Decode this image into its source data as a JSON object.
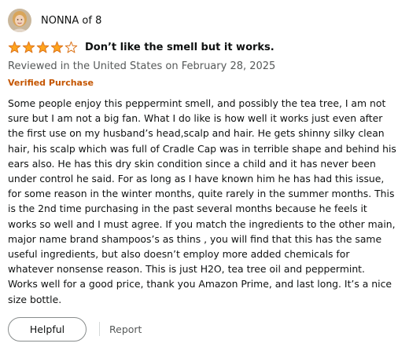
{
  "colors": {
    "star_fill": "#ffa41c",
    "star_outline": "#de7921",
    "verified": "#c45500",
    "muted_text": "#565959",
    "body_text": "#0f1111"
  },
  "review": {
    "profile_name": "NONNA of 8",
    "avatar_icon": "profile-photo",
    "rating": 4,
    "rating_max": 5,
    "title": "Don’t like the smell but it works.",
    "date_line": "Reviewed in the United States on February 28, 2025",
    "badge": "Verified Purchase",
    "body_lines": [
      "Some people enjoy this peppermint smell, and possibly the tea tree, I am not",
      "sure but I am not a big fan. What I do like is how well it works just even after",
      "the first use on my husband’s head,scalp and hair. He gets shinny silky clean",
      "hair, his scalp which was full of Cradle Cap was in terrible shape and behind his",
      "ears also. He has this dry skin condition since a child and it has never been",
      "under control he said. For as long as I have known him he has had this issue,",
      "for some reason in the winter months, quite rarely in the summer months. This",
      "is the 2nd time purchasing in the past several months because he feels it",
      "works so well and I must agree. If you match the ingredients to the other main,",
      "major name brand shampoos’s as thins , you will find that this has the same",
      "useful ingredients, but also doesn’t employ more added chemicals for",
      "whatever nonsense reason. This is just H2O, tea tree oil and peppermint.",
      "Works well for a good price, thank you Amazon Prime, and last long. It’s a nice",
      "size bottle."
    ]
  },
  "actions": {
    "helpful_label": "Helpful",
    "report_label": "Report"
  }
}
